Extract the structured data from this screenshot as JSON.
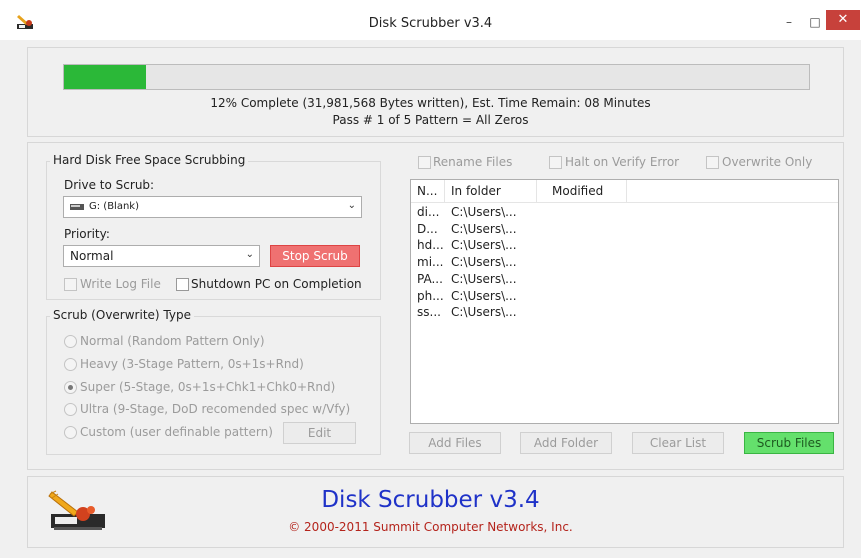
{
  "window": {
    "title": "Disk Scrubber v3.4",
    "minimize": "–",
    "maximize": "□",
    "close": "✕"
  },
  "progress": {
    "fraction": 0.11,
    "line1": "12% Complete (31,981,568 Bytes written), Est. Time Remain: 08 Minutes",
    "line2": "Pass # 1 of 5  Pattern = All Zeros",
    "color": "#2bb838"
  },
  "scrub_group": {
    "title": "Hard Disk Free Space Scrubbing",
    "drive_label": "Drive to Scrub:",
    "drive_value": "G: (Blank)",
    "priority_label": "Priority:",
    "priority_value": "Normal",
    "stop_button": "Stop Scrub",
    "write_log": "Write Log File",
    "shutdown": "Shutdown PC on Completion"
  },
  "type_group": {
    "title": "Scrub (Overwrite) Type",
    "options": [
      "Normal (Random Pattern Only)",
      "Heavy (3-Stage Pattern, 0s+1s+Rnd)",
      "Super (5-Stage, 0s+1s+Chk1+Chk0+Rnd)",
      "Ultra (9-Stage, DoD recomended spec w/Vfy)",
      "Custom (user definable pattern)"
    ],
    "selected_index": 2,
    "edit_button": "Edit"
  },
  "file_options": {
    "rename": "Rename Files",
    "halt": "Halt on Verify Error",
    "overwrite": "Overwrite Only"
  },
  "file_list": {
    "columns": [
      "N...",
      "In folder",
      "Modified"
    ],
    "rows": [
      [
        "di...",
        "C:\\Users\\..."
      ],
      [
        "D...",
        "C:\\Users\\..."
      ],
      [
        "hd...",
        "C:\\Users\\..."
      ],
      [
        "mi...",
        "C:\\Users\\..."
      ],
      [
        "PA...",
        "C:\\Users\\..."
      ],
      [
        "ph...",
        "C:\\Users\\..."
      ],
      [
        "ss...",
        "C:\\Users\\..."
      ]
    ]
  },
  "file_buttons": {
    "add_files": "Add Files",
    "add_folder": "Add Folder",
    "clear_list": "Clear List",
    "scrub_files": "Scrub Files"
  },
  "footer": {
    "title": "Disk Scrubber v3.4",
    "title_color": "#1f32c8",
    "copyright": "© 2000-2011 Summit Computer Networks, Inc.",
    "copyright_color": "#b4241c"
  }
}
